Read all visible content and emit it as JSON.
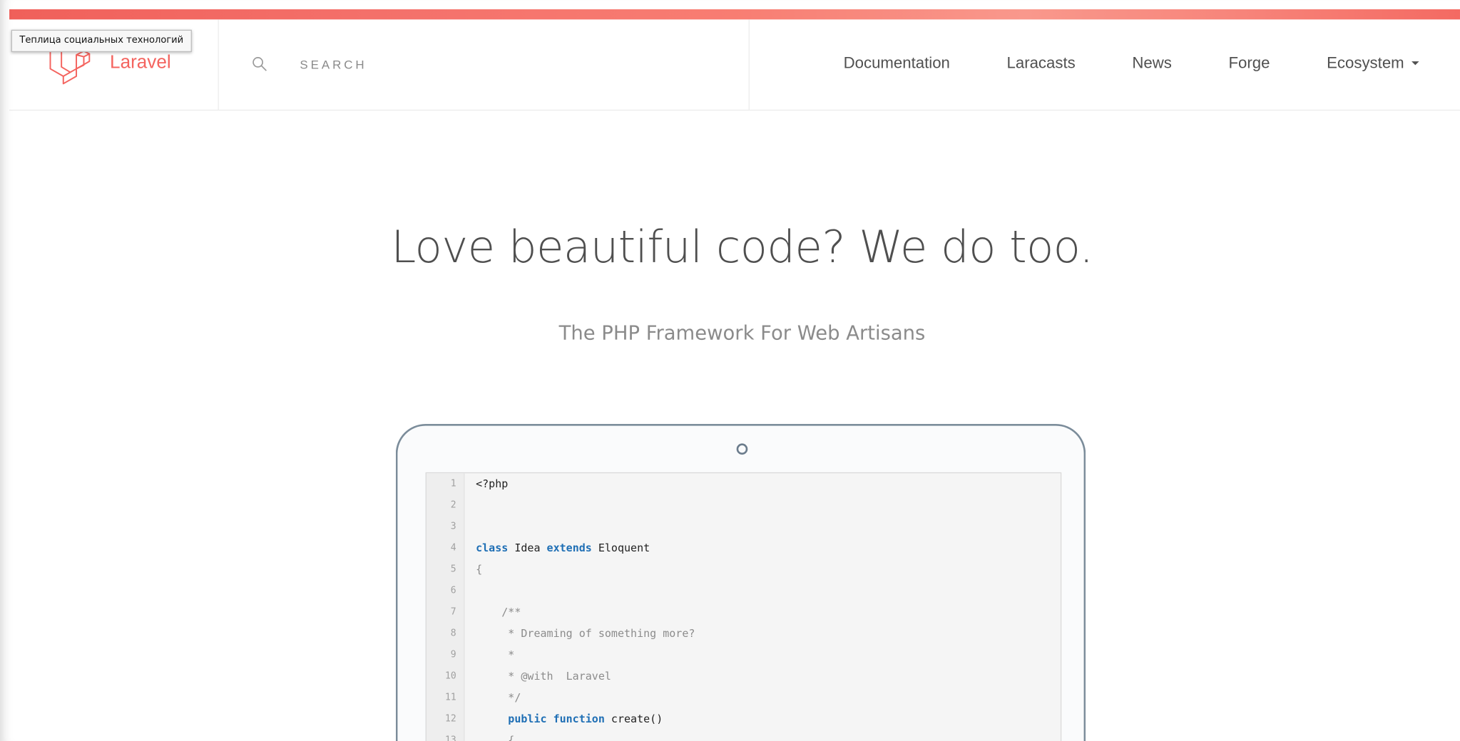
{
  "tooltip": "Теплица социальных технологий",
  "header": {
    "logo_text": "Laravel",
    "search_placeholder": "SEARCH",
    "nav": [
      {
        "label": "Documentation"
      },
      {
        "label": "Laracasts"
      },
      {
        "label": "News"
      },
      {
        "label": "Forge"
      },
      {
        "label": "Ecosystem",
        "has_dropdown": true
      }
    ]
  },
  "hero": {
    "title": "Love beautiful code? We do too.",
    "subtitle": "The PHP Framework For Web Artisans"
  },
  "code_sample": {
    "lines": [
      {
        "n": "1",
        "tokens": [
          {
            "t": "<?php",
            "c": "pl"
          }
        ]
      },
      {
        "n": "2",
        "tokens": []
      },
      {
        "n": "3",
        "tokens": []
      },
      {
        "n": "4",
        "tokens": [
          {
            "t": "class ",
            "c": "kw"
          },
          {
            "t": "Idea ",
            "c": "pl"
          },
          {
            "t": "extends ",
            "c": "kw"
          },
          {
            "t": "Eloquent",
            "c": "pl"
          }
        ]
      },
      {
        "n": "5",
        "tokens": [
          {
            "t": "{",
            "c": "cm"
          }
        ]
      },
      {
        "n": "6",
        "tokens": []
      },
      {
        "n": "7",
        "tokens": [
          {
            "t": "    /**",
            "c": "cm"
          }
        ]
      },
      {
        "n": "8",
        "tokens": [
          {
            "t": "     * Dreaming of something more?",
            "c": "cm"
          }
        ]
      },
      {
        "n": "9",
        "tokens": [
          {
            "t": "     *",
            "c": "cm"
          }
        ]
      },
      {
        "n": "10",
        "tokens": [
          {
            "t": "     * @with  Laravel",
            "c": "cm"
          }
        ]
      },
      {
        "n": "11",
        "tokens": [
          {
            "t": "     */",
            "c": "cm"
          }
        ]
      },
      {
        "n": "12",
        "tokens": [
          {
            "t": "     public function ",
            "c": "kw"
          },
          {
            "t": "create()",
            "c": "pl"
          }
        ]
      },
      {
        "n": "13",
        "tokens": [
          {
            "t": "     {",
            "c": "cm"
          }
        ]
      }
    ]
  },
  "colors": {
    "brand": "#f4645f",
    "keyword": "#1f6fb5",
    "comment": "#8c8c8c"
  }
}
